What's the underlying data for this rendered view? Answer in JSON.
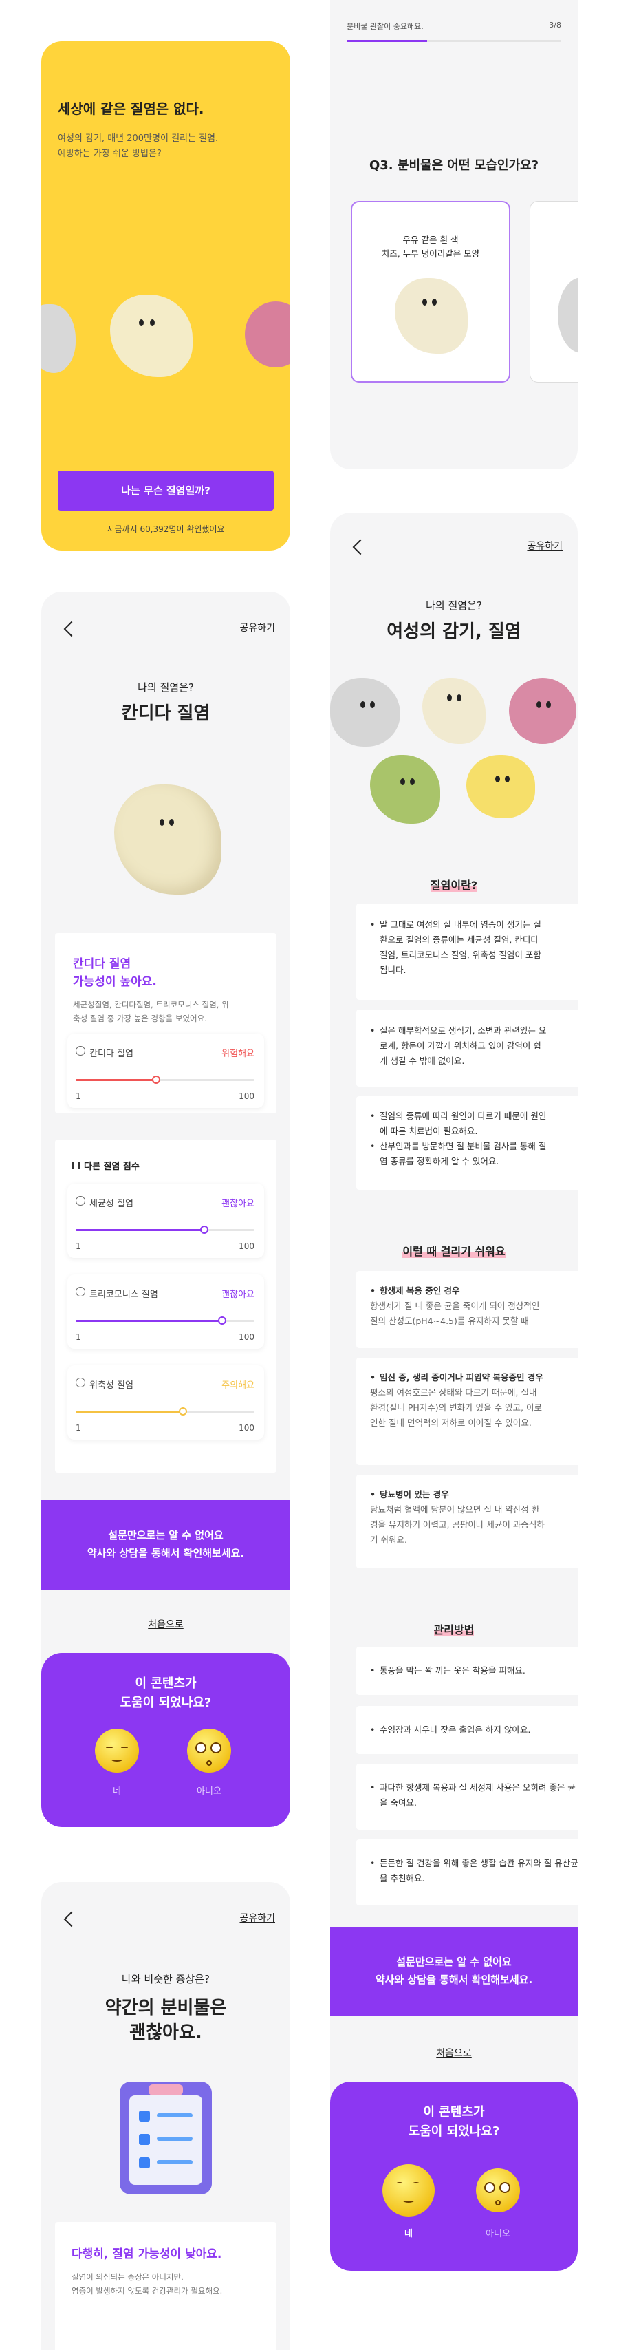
{
  "intro": {
    "title": "세상에 같은 질염은 없다.",
    "desc1": "여성의 감기, 매년 200만명이 걸리는 질염.",
    "desc2": "예방하는 가장 쉬운 방법은?",
    "cta": "나는 무슨 질염일까?",
    "count": "지금까지 60,392명이 확인했어요"
  },
  "quiz": {
    "top_text": "분비물 관찰이 중요해요.",
    "progress": "3/8",
    "question": "Q3. 분비물은 어떤 모습인가요?",
    "option1_line1": "우유 같은 흰 색",
    "option1_line2": "치즈, 두부 덩어리같은 모양"
  },
  "candida": {
    "share": "공유하기",
    "sub": "나의 질염은?",
    "title": "칸디다 질염",
    "headline1": "칸디다 질염",
    "headline2": "가능성이 높아요.",
    "desc1": "세균성질염, 칸디다질염, 트리코모니스 질염, 위",
    "desc2": "축성 질염 중 가장 높은 경향을 보였어요.",
    "main_item": {
      "name": "칸디다 질염",
      "status": "위험해요",
      "value": 0.45,
      "min": "1",
      "max": "100"
    },
    "other_title": "다른 질염 점수",
    "others": [
      {
        "name": "세균성 질염",
        "status": "괜찮아요",
        "value": 0.72,
        "min": "1",
        "max": "100"
      },
      {
        "name": "트리코모니스 질염",
        "status": "괜찮아요",
        "value": 0.82,
        "min": "1",
        "max": "100"
      },
      {
        "name": "위축성 질염",
        "status": "주의해요",
        "value": 0.6,
        "min": "1",
        "max": "100"
      }
    ],
    "banner1": "설문만으로는 알 수 없어요",
    "banner2": "약사와 상담을 통해서 확인해보세요.",
    "restart": "처음으로"
  },
  "feedback": {
    "q1": "이 콘텐츠가",
    "q2": "도움이 되었나요?",
    "yes": "네",
    "no": "아니오"
  },
  "normal": {
    "share": "공유하기",
    "sub": "나와 비슷한 증상은?",
    "title1": "약간의 분비물은",
    "title2": "괜찮아요.",
    "headline": "다행히, 질염 가능성이 낮아요.",
    "desc1": "질염이 의심되는 증상은 아니지만,",
    "desc2": "염증이 발생하지 않도록 건강관리가 필요해요."
  },
  "info": {
    "share": "공유하기",
    "sub": "나의 질염은?",
    "title": "여성의 감기, 질염",
    "what_title": "질염이란?",
    "what_1": [
      "말 그대로 여성의 질 내부에 염증이 생기는 질",
      "환으로 질염의 종류에는 세균성 질염, 칸디다",
      "질염, 트리코모니스 질염, 위축성 질염이 포함",
      "됩니다."
    ],
    "what_2": [
      "질은 해부학적으로 생식기, 소변과 관련있는 요",
      "로계, 항문이 가깝게 위치하고 있어 감염이 쉽",
      "게 생길 수 밖에 없어요."
    ],
    "what_3a": [
      "질염의 종류에 따라 원인이 다르기 때문에 원인",
      "에 따른 치료법이 필요해요."
    ],
    "what_3b": [
      "산부인과를 방문하면 질 분비물 검사를 통해 질",
      "염 종류를 정확하게 알 수 있어요."
    ],
    "risk_title": "이럴 때 걸리기 쉬워요",
    "risk_1_title": "항생제 복용 중인 경우",
    "risk_1": [
      "항생제가 질 내 좋은 균을 죽이게 되어 정상적인",
      "질의 산성도(pH4~4.5)를 유지하지 못할 때"
    ],
    "risk_2_title": [
      "임신 중, 생리 중이거나 피임약 복용중인 경우"
    ],
    "risk_2": [
      "평소의 여성호르몬 상태와 다르기 때문에, 질내",
      "환경(질내 PH지수)의 변화가 있을 수 있고, 이로",
      "인한 질내 면역력의 저하로 이어질 수 있어요."
    ],
    "risk_3_title": "당뇨병이 있는 경우",
    "risk_3": [
      "당뇨처럼 혈액에 당분이 많으면 질 내 약산성 환",
      "경을 유지하기 어렵고, 곰팡이나 세균이 과증식하",
      "기 쉬워요."
    ],
    "care_title": "관리방법",
    "care": [
      "통풍을 막는 꽉 끼는 옷은 착용을 피해요.",
      "수영장과 사우나 잦은 출입은 하지 않아요.",
      "과다한 항생제 복용과 질 세정제 사용은 오히려 좋은 균을 죽여요.",
      "든든한 질 건강을 위해 좋은 생활 습관 유지와 질 유산균을 추천해요."
    ],
    "banner1": "설문만으로는 알 수 없어요",
    "banner2": "약사와 상담을 통해서 확인해보세요.",
    "restart": "처음으로"
  },
  "colors": {
    "accent": "#8c37f2",
    "danger": "#f05555",
    "warn": "#f5c242",
    "yellow": "#ffd43b"
  }
}
